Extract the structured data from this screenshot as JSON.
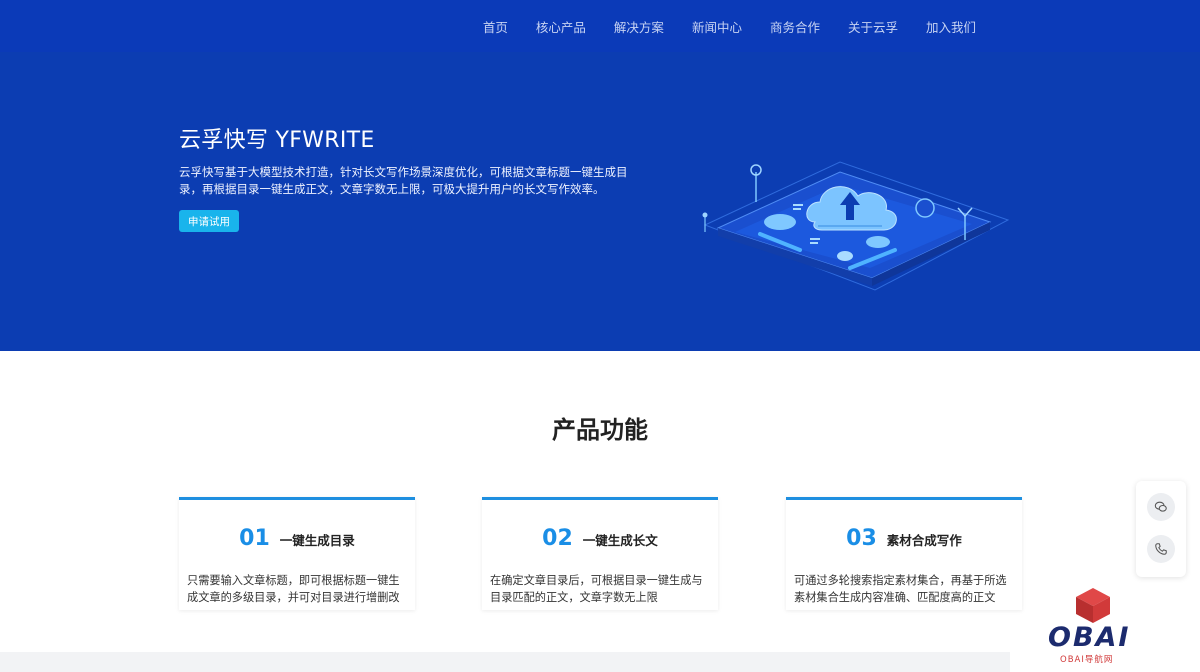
{
  "nav": {
    "items": [
      "首页",
      "核心产品",
      "解决方案",
      "新闻中心",
      "商务合作",
      "关于云孚",
      "加入我们"
    ]
  },
  "hero": {
    "title": "云孚快写 YFWRITE",
    "description": "云孚快写基于大模型技术打造，针对长文写作场景深度优化，可根据文章标题一键生成目录，再根据目录一键生成正文，文章字数无上限，可极大提升用户的长文写作效率。",
    "button_label": "申请试用"
  },
  "features": {
    "title": "产品功能",
    "cards": [
      {
        "num": "01",
        "name": "一键生成目录",
        "desc": "只需要输入文章标题，即可根据标题一键生成文章的多级目录，并可对目录进行增删改"
      },
      {
        "num": "02",
        "name": "一键生成长文",
        "desc": "在确定文章目录后，可根据目录一键生成与目录匹配的正文，文章字数无上限"
      },
      {
        "num": "03",
        "name": "素材合成写作",
        "desc": "可通过多轮搜索指定素材集合，再基于所选素材集合生成内容准确、匹配度高的正文"
      }
    ]
  },
  "float_bar": {
    "icons": [
      "wechat-icon",
      "phone-icon"
    ]
  },
  "watermark": {
    "logo_text": "OBAI",
    "sub_text": "OBAI导航网"
  },
  "colors": {
    "hero_bg": "#0c3db2",
    "accent": "#1a8ee6",
    "button": "#19b4ec"
  }
}
